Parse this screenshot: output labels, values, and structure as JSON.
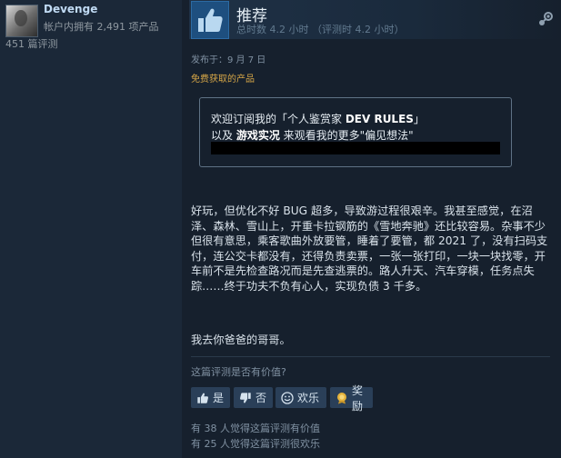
{
  "author": {
    "name": "Devenge",
    "products_owned": "帐户内拥有 2,491 项产品",
    "reviews_count": "451 篇评测"
  },
  "review": {
    "verdict": "推荐",
    "hours": "总时数 4.2 小时  （评测时 4.2 小时）",
    "posted": "发布于：9 月 7 日",
    "free_tag": "免费获取的产品",
    "curator": {
      "line1_pre": "欢迎订阅我的「个人鉴赏家 ",
      "line1_bold": "DEV RULES",
      "line1_post": "」",
      "line2_pre": "以及 ",
      "line2_bold": "游戏实况",
      "line2_post": " 来观看我的更多\"偏见想法\""
    },
    "body": "好玩，但优化不好 BUG 超多，导致游过程很艰辛。我甚至感觉，在沼泽、森林、雪山上，开重卡拉钢筋的《雪地奔驰》还比较容易。杂事不少但很有意思，乘客歌曲外放要管，睡着了要管，都 2021 了，没有扫码支付，连公交卡都没有，还得负责卖票，一张一张打印，一块一块找零，开车前不是先检查路况而是先查逃票的。路人升天、汽车穿模，任务点失踪……终于功夫不负有心人，实现负债 3 千多。",
    "sign_off": "我去你爸爸的哥哥。"
  },
  "feedback": {
    "question": "这篇评测是否有价值?",
    "yes_label": "是",
    "no_label": "否",
    "funny_label": "欢乐",
    "award_label": "奖励",
    "helpful_stat": "有 38 人觉得这篇评测有价值",
    "funny_stat": "有 25 人觉得这篇评测很欢乐"
  },
  "colors": {
    "background": "#1b2838",
    "panel": "#16202d",
    "free_tag": "#d6a647",
    "button": "#2a3f58",
    "thumb": "#1e4f7f"
  },
  "icons": [
    "thumbs-up-icon",
    "steam-icon",
    "thumbs-down-icon",
    "smiley-icon",
    "award-icon"
  ]
}
